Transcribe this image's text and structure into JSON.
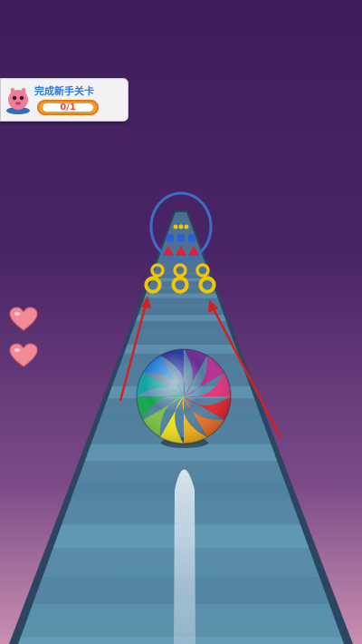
{
  "task": {
    "title": "完成新手关卡",
    "progress_text": "0/1",
    "progress_value": 0.0
  },
  "lives": {
    "count": 2,
    "icon": "heart-icon"
  },
  "colors": {
    "bg_top": "#3f1d5a",
    "bg_bottom": "#c98fb0",
    "road": "#5a8fab",
    "road_edge": "#2c4563",
    "ring_gate": "#3a6fc4",
    "coin": "#f5c400",
    "arrow": "#d4201f",
    "heart": "#f08a96"
  },
  "ball": {
    "pattern": "rainbow-swirl"
  }
}
